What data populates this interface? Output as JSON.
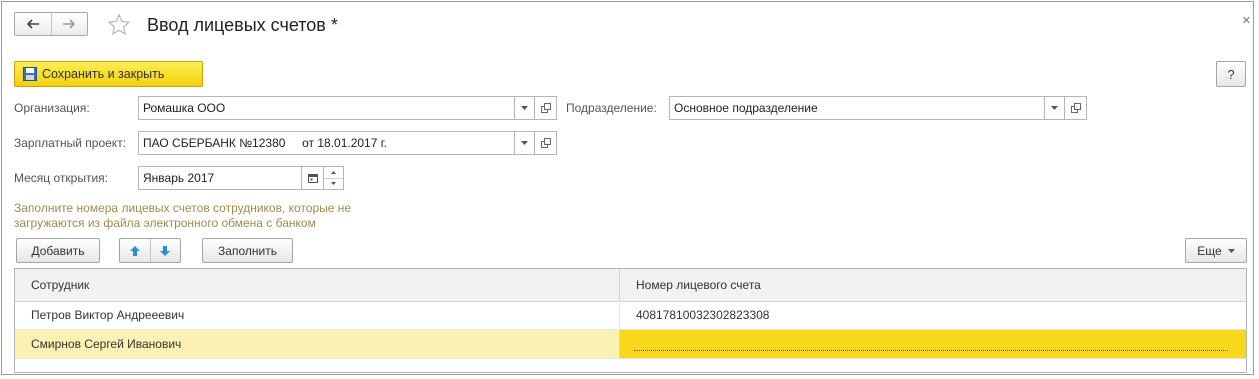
{
  "window": {
    "title": "Ввод лицевых счетов *",
    "close_glyph": "×"
  },
  "toolbar": {
    "save_close_label": "Сохранить и закрыть",
    "help_label": "?"
  },
  "form": {
    "organization": {
      "label": "Организация:",
      "value": "Ромашка ООО"
    },
    "division": {
      "label": "Подразделение:",
      "value": "Основное подразделение"
    },
    "salary_project": {
      "label": "Зарплатный проект:",
      "value": "ПАО СБЕРБАНК №12380     от 18.01.2017 г."
    },
    "month": {
      "label": "Месяц открытия:",
      "value": "Январь 2017"
    }
  },
  "hint_text": "Заполните номера лицевых счетов сотрудников, которые не загружаются из файла электронного обмена с банком",
  "table_toolbar": {
    "add_label": "Добавить",
    "fill_label": "Заполнить",
    "more_label": "Еще"
  },
  "table": {
    "columns": [
      "Сотрудник",
      "Номер лицевого счета"
    ],
    "rows": [
      {
        "employee": "Петров Виктор Андрееевич",
        "account": "40817810032302823308"
      },
      {
        "employee": "Смирнов Сергей Иванович",
        "account": ""
      }
    ]
  },
  "icons": {
    "back": "arrow-left-icon",
    "forward": "arrow-right-icon",
    "favorite": "star-icon",
    "save": "floppy-disk-icon",
    "dropdown": "triangle-down-icon",
    "open": "open-form-icon",
    "calendar": "calendar-icon",
    "move_up": "arrow-up-icon",
    "move_down": "arrow-down-icon"
  },
  "colors": {
    "accent_yellow": "#f3d00c",
    "selected_row": "#fbf1b3",
    "active_cell": "#f8d81a",
    "hint_text": "#a08c4e",
    "move_arrows": "#2b8fd6"
  }
}
